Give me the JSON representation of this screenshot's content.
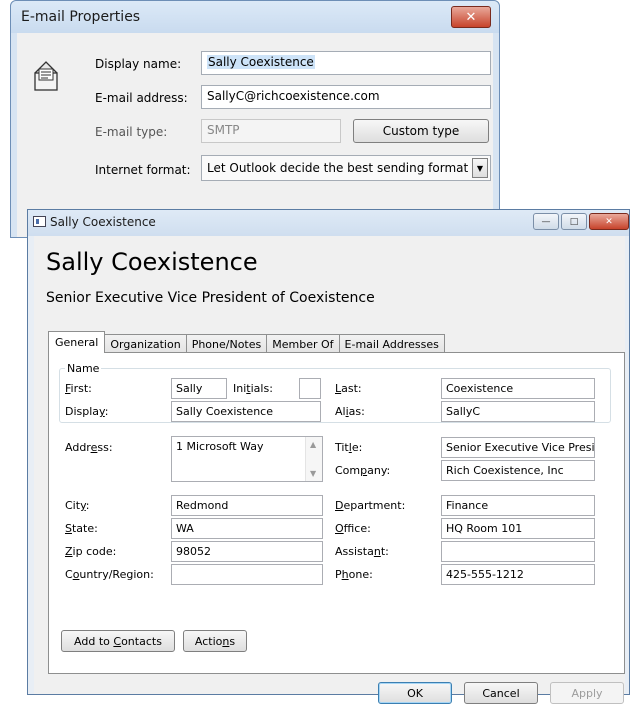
{
  "email_dialog": {
    "title": "E-mail Properties",
    "close_glyph": "✕",
    "icon": "email-document-icon",
    "display_name_label": "Display name:",
    "display_name_value": "Sally Coexistence",
    "email_address_label": "E-mail address:",
    "email_address_value": "SallyC@richcoexistence.com",
    "email_type_label": "E-mail type:",
    "email_type_value": "SMTP",
    "custom_type_button": "Custom type",
    "internet_format_label": "Internet format:",
    "internet_format_value": "Let Outlook decide the best sending format",
    "dropdown_arrow": "▼"
  },
  "contact_window": {
    "title": "Sally Coexistence",
    "caption": {
      "minimize": "—",
      "maximize": "□",
      "close": "✕"
    },
    "header_name": "Sally Coexistence",
    "header_title": "Senior Executive Vice President of Coexistence",
    "tabs": [
      "General",
      "Organization",
      "Phone/Notes",
      "Member Of",
      "E-mail Addresses"
    ],
    "selected_tab": "General",
    "name_group": {
      "label": "Name",
      "first_label": "First:",
      "first_value": "Sally",
      "initials_label": "Initials:",
      "initials_value": "",
      "last_label": "Last:",
      "last_value": "Coexistence",
      "display_label": "Display:",
      "display_value": "Sally Coexistence",
      "alias_label": "Alias:",
      "alias_value": "SallyC"
    },
    "address": {
      "address_label": "Address:",
      "address_value": "1 Microsoft Way",
      "city_label": "City:",
      "city_value": "Redmond",
      "state_label": "State:",
      "state_value": "WA",
      "zip_label": "Zip code:",
      "zip_value": "98052",
      "country_label": "Country/Region:",
      "country_value": ""
    },
    "org": {
      "title_label": "Title:",
      "title_value": "Senior Executive Vice President of Coexistence",
      "company_label": "Company:",
      "company_value": "Rich Coexistence, Inc",
      "department_label": "Department:",
      "department_value": "Finance",
      "office_label": "Office:",
      "office_value": "HQ Room 101",
      "assistant_label": "Assistant:",
      "assistant_value": "",
      "phone_label": "Phone:",
      "phone_value": "425-555-1212"
    },
    "buttons": {
      "add_to_contacts": "Add to Contacts",
      "actions": "Actions",
      "ok": "OK",
      "cancel": "Cancel",
      "apply": "Apply"
    },
    "scroll_up": "▲",
    "scroll_down": "▼"
  },
  "colors": {
    "accent": "#3c7fb1",
    "titlebar": "#c9dbef",
    "close_red": "#c7432b",
    "selection": "#cde3f8"
  }
}
